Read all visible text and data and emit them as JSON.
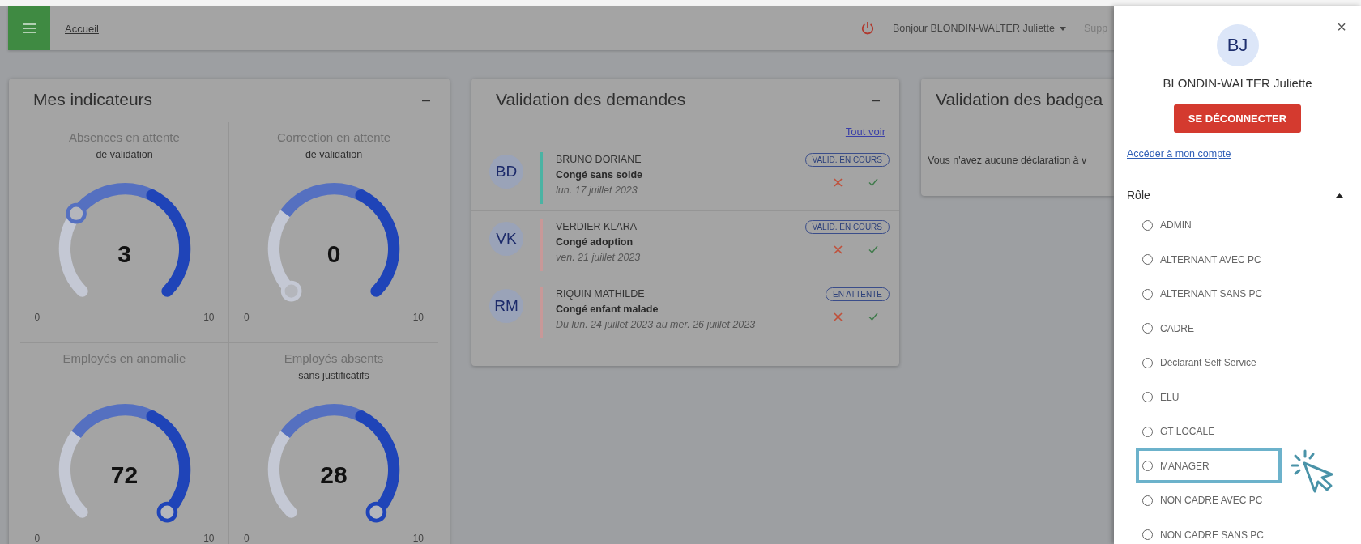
{
  "topbar": {
    "breadcrumb": "Accueil",
    "greeting": "Bonjour BLONDIN-WALTER Juliette",
    "support": "Supp"
  },
  "indicators": {
    "title": "Mes indicateurs",
    "collapse": "–",
    "gauges": [
      {
        "title": "Absences en attente",
        "subtitle": "de validation",
        "value": "3",
        "min": "0",
        "max": "10"
      },
      {
        "title": "Correction en attente",
        "subtitle": "de validation",
        "value": "0",
        "min": "0",
        "max": "10"
      },
      {
        "title": "Employés en anomalie",
        "value": "72",
        "min": "0",
        "max": "10"
      },
      {
        "title": "Employés absents",
        "subtitle": "sans justificatifs",
        "value": "28",
        "min": "0",
        "max": "10"
      }
    ]
  },
  "requests": {
    "title": "Validation des demandes",
    "collapse": "–",
    "see_all": "Tout voir",
    "items": [
      {
        "initials": "BD",
        "name": "BRUNO DORIANE",
        "type": "Congé sans solde",
        "date": "lun. 17 juillet 2023",
        "status": "VALID. EN COURS",
        "color": "#4bb3a3"
      },
      {
        "initials": "VK",
        "name": "VERDIER KLARA",
        "type": "Congé adoption",
        "date": "ven. 21 juillet 2023",
        "status": "VALID. EN COURS",
        "color": "#c89898"
      },
      {
        "initials": "RM",
        "name": "RIQUIN MATHILDE",
        "type": "Congé enfant malade",
        "date": "Du lun. 24 juillet 2023 au mer. 26 juillet 2023",
        "status": "EN ATTENTE",
        "color": "#c89898"
      }
    ]
  },
  "badges": {
    "title": "Validation des badgea",
    "message": "Vous n'avez aucune déclaration à v"
  },
  "drawer": {
    "close": "×",
    "initials": "BJ",
    "name": "BLONDIN-WALTER Juliette",
    "logout": "SE DÉCONNECTER",
    "account_link": "Accéder à mon compte",
    "section": {
      "title": "Rôle",
      "expanded": true
    },
    "roles": [
      {
        "label": "ADMIN",
        "selected": false,
        "highlighted": false
      },
      {
        "label": "ALTERNANT AVEC PC",
        "selected": false,
        "highlighted": false
      },
      {
        "label": "ALTERNANT SANS PC",
        "selected": false,
        "highlighted": false
      },
      {
        "label": "CADRE",
        "selected": false,
        "highlighted": false
      },
      {
        "label": "Déclarant Self Service",
        "selected": false,
        "highlighted": false
      },
      {
        "label": "ELU",
        "selected": false,
        "highlighted": false
      },
      {
        "label": "GT LOCALE",
        "selected": false,
        "highlighted": false
      },
      {
        "label": "MANAGER",
        "selected": false,
        "highlighted": true
      },
      {
        "label": "NON CADRE AVEC PC",
        "selected": false,
        "highlighted": false
      },
      {
        "label": "NON CADRE SANS PC",
        "selected": false,
        "highlighted": false
      }
    ]
  }
}
